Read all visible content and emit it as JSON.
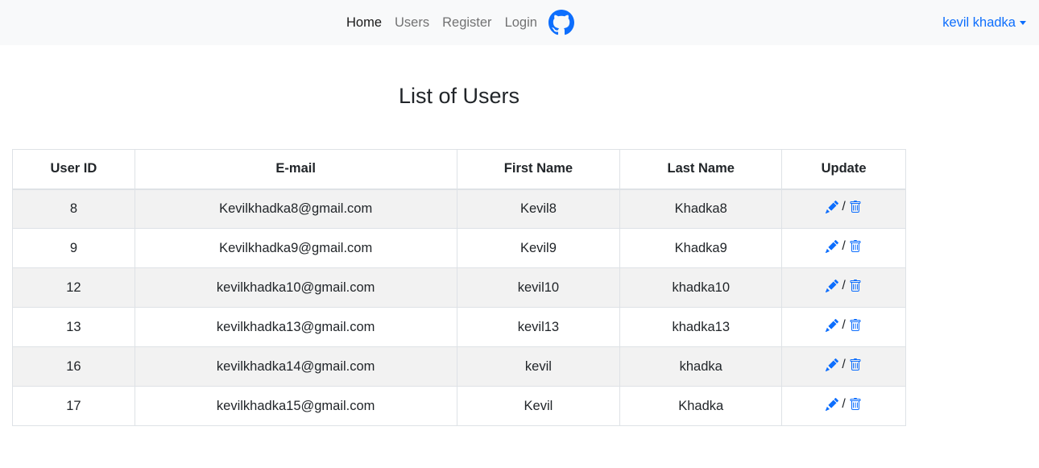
{
  "navbar": {
    "links": [
      {
        "label": "Home"
      },
      {
        "label": "Users"
      },
      {
        "label": "Register"
      },
      {
        "label": "Login"
      }
    ],
    "github_icon": "github-icon",
    "user_menu": {
      "label": "kevil khadka",
      "icon": "caret-down-icon"
    }
  },
  "page": {
    "title": "List of Users"
  },
  "table": {
    "columns": [
      "User ID",
      "E-mail",
      "First Name",
      "Last Name",
      "Update"
    ],
    "rows": [
      {
        "id": "8",
        "email": "Kevilkhadka8@gmail.com",
        "first": "Kevil8",
        "last": "Khadka8"
      },
      {
        "id": "9",
        "email": "Kevilkhadka9@gmail.com",
        "first": "Kevil9",
        "last": "Khadka9"
      },
      {
        "id": "12",
        "email": "kevilkhadka10@gmail.com",
        "first": "kevil10",
        "last": "khadka10"
      },
      {
        "id": "13",
        "email": "kevilkhadka13@gmail.com",
        "first": "kevil13",
        "last": "khadka13"
      },
      {
        "id": "16",
        "email": "kevilkhadka14@gmail.com",
        "first": "kevil",
        "last": "khadka"
      },
      {
        "id": "17",
        "email": "kevilkhadka15@gmail.com",
        "first": "Kevil",
        "last": "Khadka"
      }
    ],
    "action_separator": "/",
    "edit_icon": "pencil-icon",
    "delete_icon": "trash-icon"
  },
  "colors": {
    "accent": "#0d6efd",
    "navbar_bg": "#f8f9fa",
    "stripe": "#f2f2f2",
    "border": "#dee2e6"
  }
}
